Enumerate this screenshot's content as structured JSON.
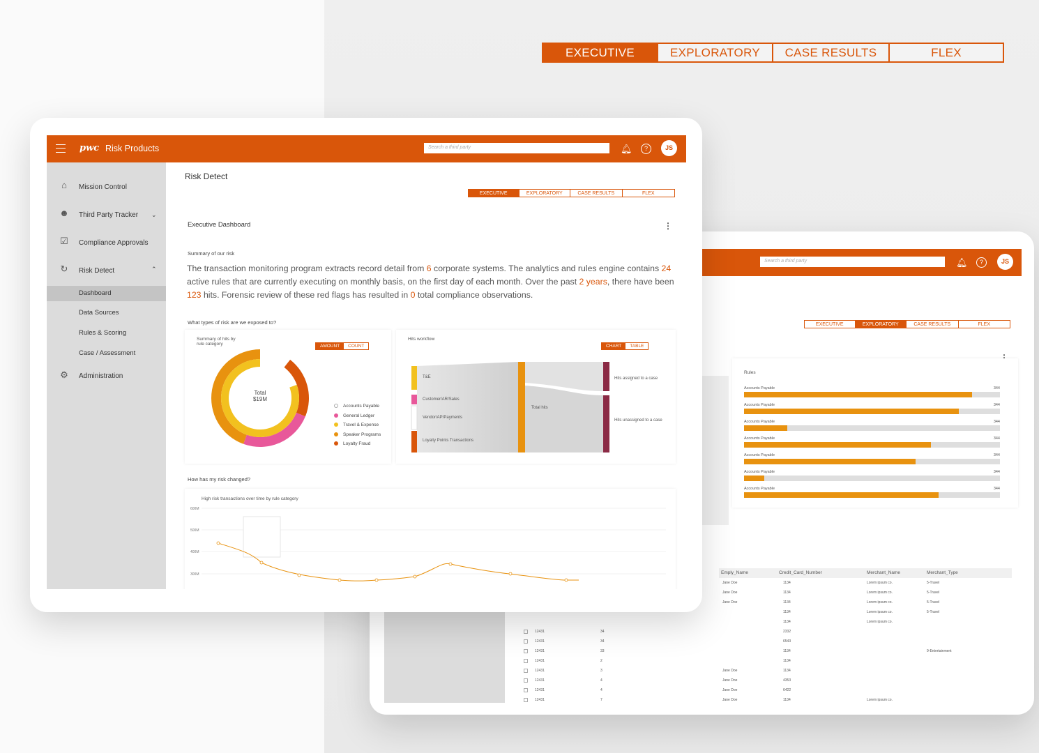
{
  "tabs_large": [
    "EXECUTIVE",
    "EXPLORATORY",
    "CASE RESULTS",
    "FLEX"
  ],
  "header": {
    "logo": "pwc",
    "product": "Risk Products",
    "search_placeholder": "Search a third party",
    "avatar": "JS"
  },
  "sidebar": {
    "items": [
      {
        "label": "Mission Control",
        "icon": "home-icon"
      },
      {
        "label": "Third Party Tracker",
        "icon": "people-icon"
      },
      {
        "label": "Compliance Approvals",
        "icon": "approval-icon"
      },
      {
        "label": "Risk Detect",
        "icon": "refresh-icon"
      },
      {
        "label": "Administration",
        "icon": "gear-icon"
      }
    ],
    "subitems": [
      "Dashboard",
      "Data Sources",
      "Rules & Scoring",
      "Case / Assessment"
    ]
  },
  "main": {
    "page_title": "Risk Detect",
    "tabs": [
      "EXECUTIVE",
      "EXPLORATORY",
      "CASE RESULTS",
      "FLEX"
    ],
    "section_title": "Executive Dashboard",
    "summary_label": "Summary of our risk",
    "summary": {
      "t1": "The transaction monitoring program extracts record detail from ",
      "n1": "6",
      "t2": " corporate systems. The analytics and rules engine contains ",
      "n2": "24",
      "t3": " active rules that are currently executing on monthly basis, on the first day of each month. Over the past ",
      "n3": "2 years",
      "t4": ", there have been ",
      "n4": "123",
      "t5": " hits. Forensic review of these red flags has resulted in ",
      "n5": "0",
      "t6": " total compliance observations."
    },
    "question1": "What types of risk are we exposed to?",
    "donut": {
      "title_line1": "Summary of hits by",
      "title_line2": "rule category",
      "toggle": [
        "AMOUNT",
        "COUNT"
      ],
      "center_line1": "Total",
      "center_line2": "$19M",
      "legend": [
        "Accounts Payable",
        "General Ledger",
        "Travel & Expense",
        "Speaker Programs",
        "Loyalty Fraud"
      ],
      "colors": [
        "#ffffff",
        "#e8589a",
        "#f2c11f",
        "#e8920f",
        "#d9560a"
      ]
    },
    "workflow": {
      "title": "Hits workflow",
      "toggle": [
        "CHART",
        "TABLE"
      ],
      "sources": [
        "T&E",
        "Customer/AR/Sales",
        "Vendor/AP/Payments",
        "Loyalty Points Transactions"
      ],
      "middle": "Total hits",
      "targets": [
        "Hits assigned to a case",
        "Hits unassigned to a case"
      ]
    },
    "question2": "How has my risk changed?",
    "line": {
      "title": "High risk transactions over time by rule category",
      "yticks": [
        "600M",
        "500M",
        "400M",
        "300M"
      ]
    }
  },
  "device2": {
    "search_placeholder": "Search a third party",
    "avatar": "JS",
    "tabs": [
      "EXECUTIVE",
      "EXPLORATORY",
      "CASE RESULTS",
      "FLEX"
    ],
    "rules_title": "Rules",
    "rules": [
      {
        "name": "Accounts Payable",
        "value": "344",
        "fill": 0.89
      },
      {
        "name": "Accounts Payable",
        "value": "344",
        "fill": 0.84
      },
      {
        "name": "Accounts Payable",
        "value": "344",
        "fill": 0.17
      },
      {
        "name": "Accounts Payable",
        "value": "344",
        "fill": 0.73
      },
      {
        "name": "Accounts Payable",
        "value": "344",
        "fill": 0.67
      },
      {
        "name": "Accounts Payable",
        "value": "344",
        "fill": 0.08
      },
      {
        "name": "Accounts Payable",
        "value": "344",
        "fill": 0.76
      }
    ],
    "table_headers": [
      "Emply_Name",
      "Credit_Card_Number",
      "Merchant_Name",
      "Merchant_Type"
    ],
    "table_rows": [
      [
        "",
        "",
        "Jane Doe",
        "1134",
        "Lorem ipsum co.",
        "5-Travel"
      ],
      [
        "",
        "",
        "Jane Doe",
        "1134",
        "Lorem ipsum co.",
        "5-Travel"
      ],
      [
        "",
        "",
        "Jane Doe",
        "1134",
        "Lorem ipsum co.",
        "5-Travel"
      ],
      [
        "",
        "",
        "",
        "1134",
        "Lorem ipsum co.",
        "5-Travel"
      ],
      [
        "",
        "",
        "",
        "1134",
        "Lorem ipsum co.",
        ""
      ],
      [
        "12431",
        "34",
        "",
        "2332",
        "",
        ""
      ],
      [
        "12431",
        "34",
        "",
        "6543",
        "",
        ""
      ],
      [
        "12431",
        "33",
        "",
        "1134",
        "",
        "9-Entertainment"
      ],
      [
        "12431",
        "2",
        "",
        "1134",
        "",
        ""
      ],
      [
        "12431",
        "3",
        "Jane Doe",
        "1134",
        "",
        ""
      ],
      [
        "12431",
        "4",
        "Jane Doe",
        "4353",
        "",
        ""
      ],
      [
        "12431",
        "4",
        "Jane Doe",
        "6422",
        "",
        ""
      ],
      [
        "12431",
        "7",
        "Jane Doe",
        "1134",
        "Lorem ipsum co.",
        ""
      ],
      [
        "12431",
        "15",
        "",
        "1134",
        "Lorem ipsum co.",
        ""
      ],
      [
        "12431",
        "7",
        "",
        "",
        "",
        ""
      ]
    ]
  }
}
